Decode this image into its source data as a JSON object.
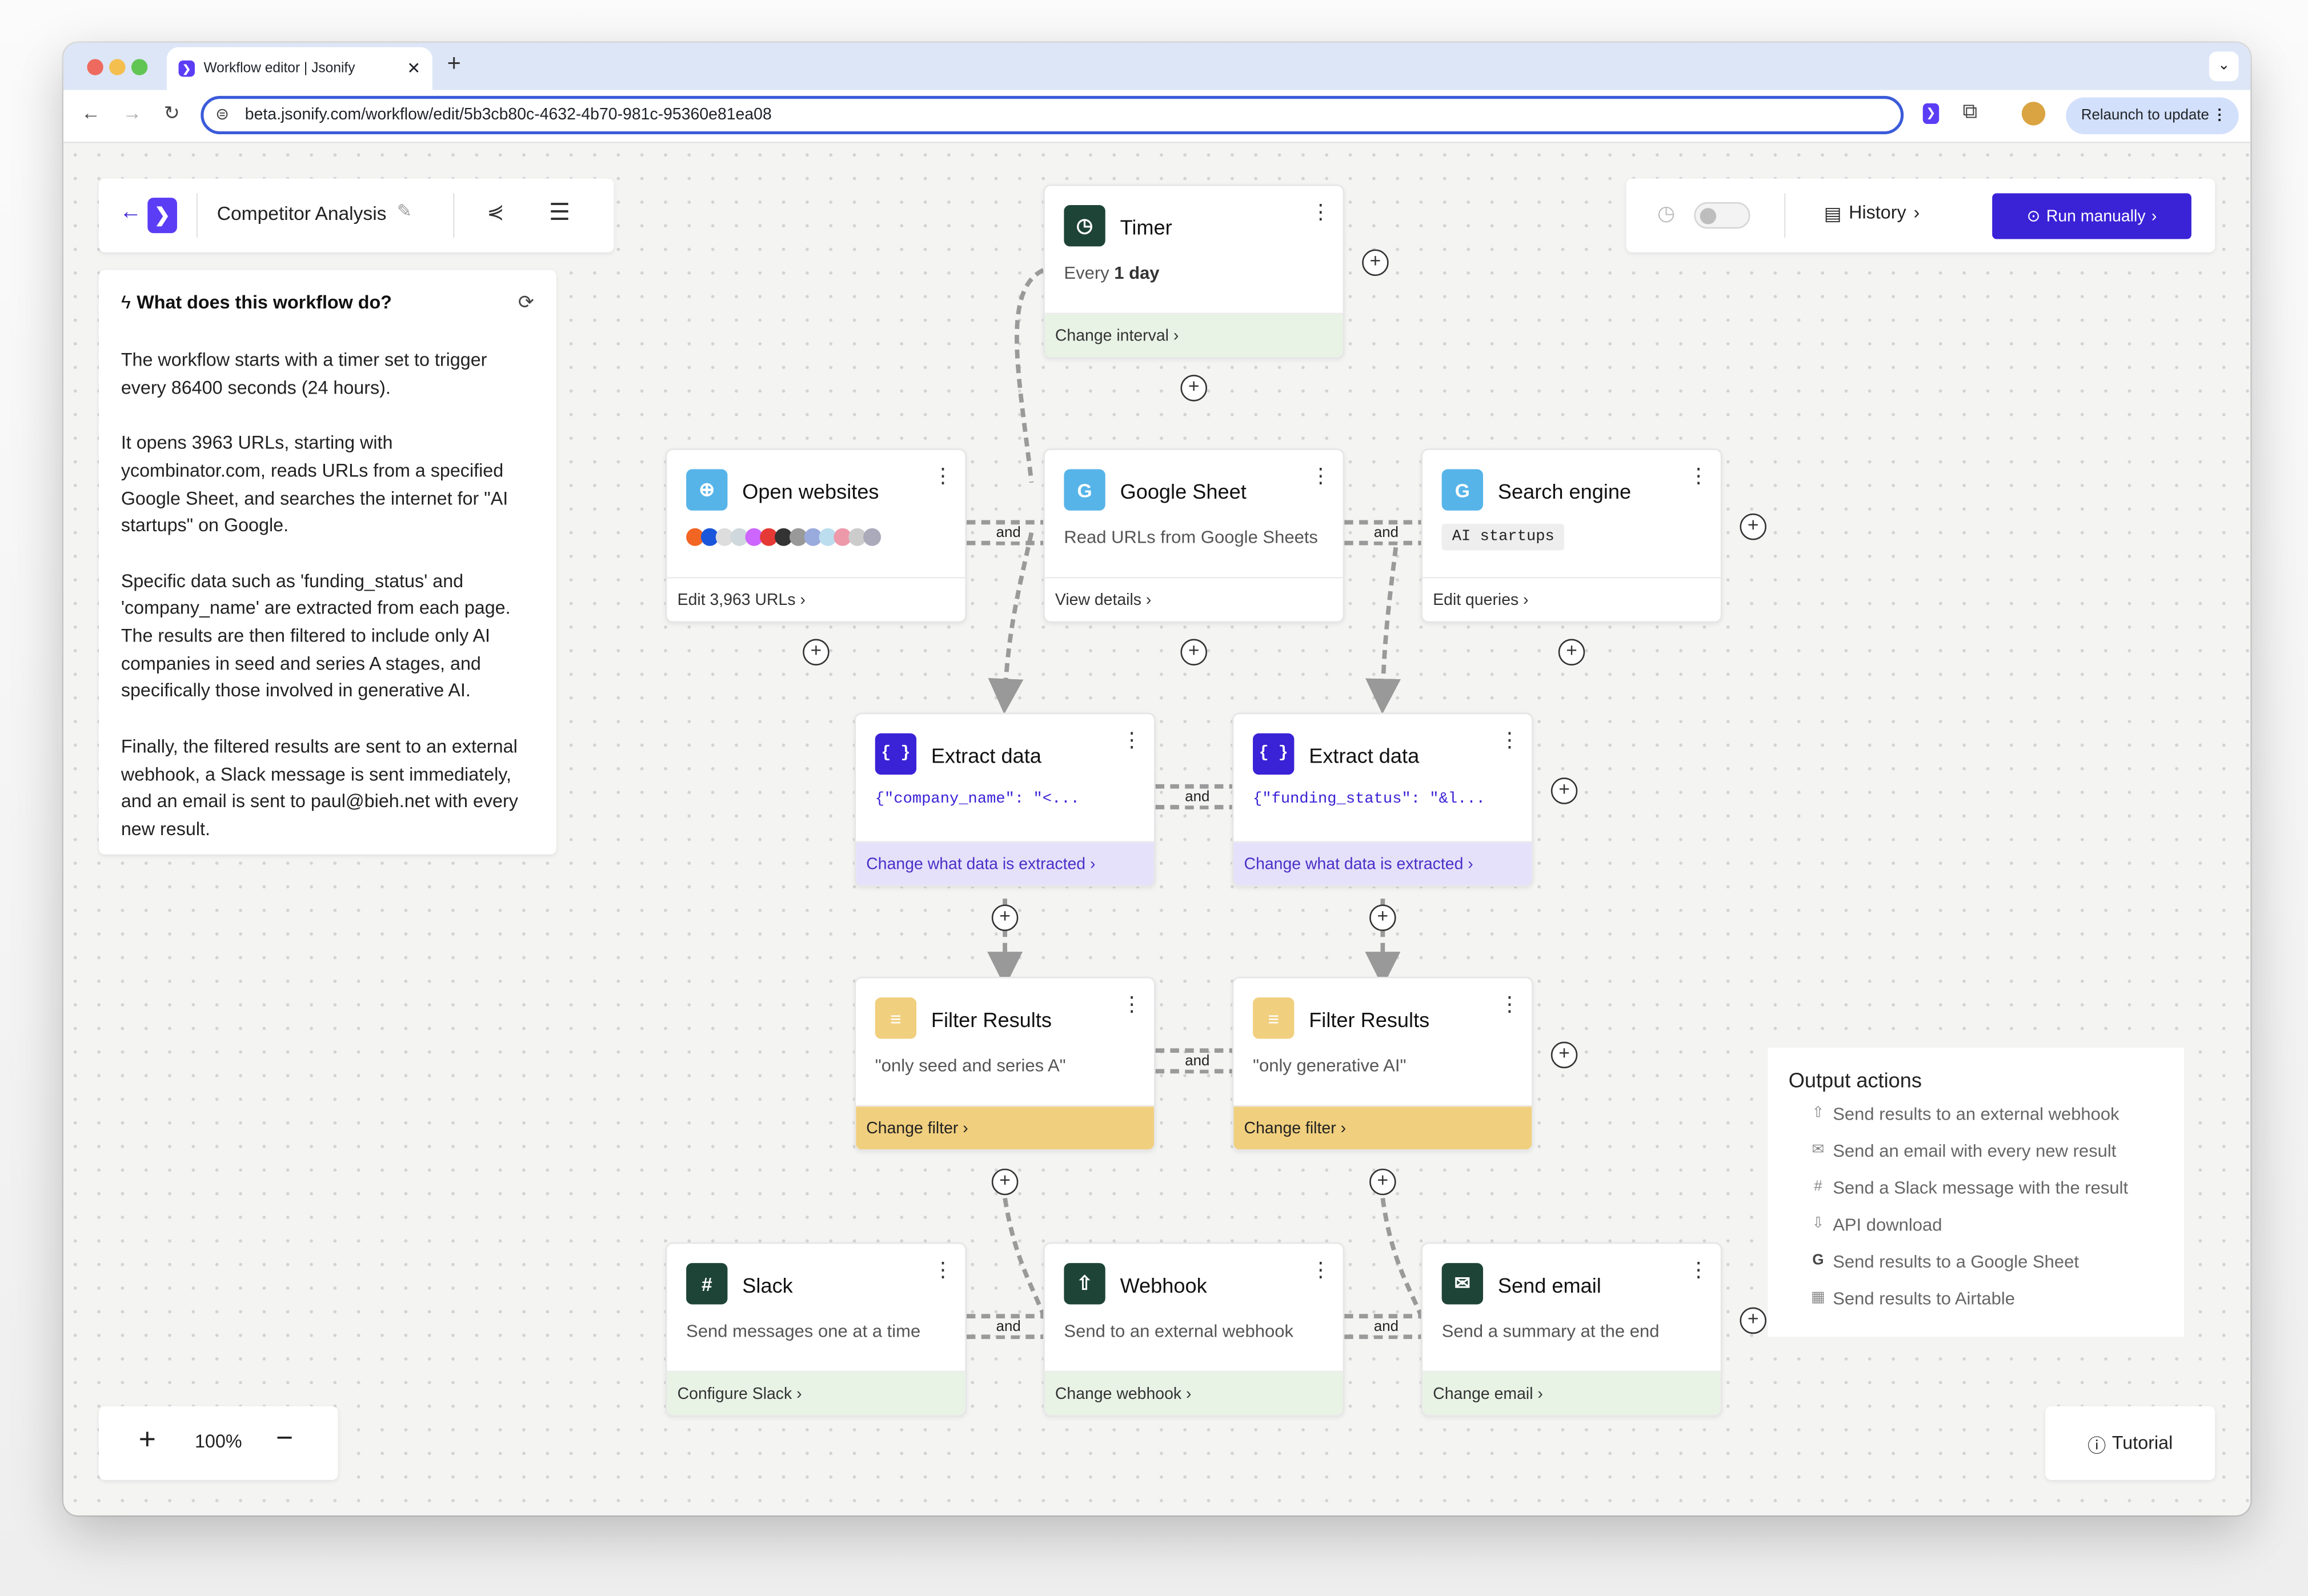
{
  "browser": {
    "tab_title": "Workflow editor | Jsonify",
    "url": "beta.jsonify.com/workflow/edit/5b3cb80c-4632-4b70-981c-95360e81ea08",
    "relaunch": "Relaunch to update"
  },
  "toolbar": {
    "title": "Competitor Analysis",
    "history": "History",
    "run": "Run manually"
  },
  "summary": {
    "heading": "What does this workflow do?",
    "p1": "The workflow starts with a timer set to trigger every 86400 seconds (24 hours).",
    "p2": "It opens 3963 URLs, starting with ycombinator.com, reads URLs from a specified Google Sheet, and searches the internet for \"AI startups\" on Google.",
    "p3": "Specific data such as 'funding_status' and 'company_name' are extracted from each page. The results are then filtered to include only AI companies in seed and series A stages, and specifically those involved in generative AI.",
    "p4": "Finally, the filtered results are sent to an external webhook, a Slack message is sent immediately, and an email is sent to paul@bieh.net with every new result."
  },
  "nodes": {
    "timer": {
      "title": "Timer",
      "desc_pre": "Every ",
      "desc_bold": "1 day",
      "foot": "Change interval"
    },
    "open": {
      "title": "Open websites",
      "foot": "Edit 3,963 URLs"
    },
    "sheet": {
      "title": "Google Sheet",
      "desc": "Read URLs from Google Sheets",
      "foot": "View details"
    },
    "search": {
      "title": "Search engine",
      "tag": "AI startups",
      "foot": "Edit queries"
    },
    "ex1": {
      "title": "Extract data",
      "code": "{\"company_name\": \"<...",
      "foot": "Change what data is extracted"
    },
    "ex2": {
      "title": "Extract data",
      "code": "{\"funding_status\": \"&l...",
      "foot": "Change what data is extracted"
    },
    "f1": {
      "title": "Filter Results",
      "desc": "\"only seed and series A\"",
      "foot": "Change filter"
    },
    "f2": {
      "title": "Filter Results",
      "desc": "\"only generative AI\"",
      "foot": "Change filter"
    },
    "slack": {
      "title": "Slack",
      "desc": "Send messages one at a time",
      "foot": "Configure Slack"
    },
    "webhook": {
      "title": "Webhook",
      "desc": "Send to an external webhook",
      "foot": "Change webhook"
    },
    "email": {
      "title": "Send email",
      "desc": "Send a summary at the end",
      "foot": "Change email"
    }
  },
  "and_label": "and",
  "output": {
    "heading": "Output actions",
    "items": [
      "Send results to an external webhook",
      "Send an email with every new result",
      "Send a Slack message with the result",
      "API download",
      "Send results to a Google Sheet",
      "Send results to Airtable"
    ]
  },
  "zoom": {
    "level": "100%"
  },
  "tutorial": "Tutorial",
  "colors": {
    "accent": "#3a22d6",
    "brand": "#5b3df5",
    "node_dark": "#1e4437",
    "node_blue": "#56b4e9"
  }
}
